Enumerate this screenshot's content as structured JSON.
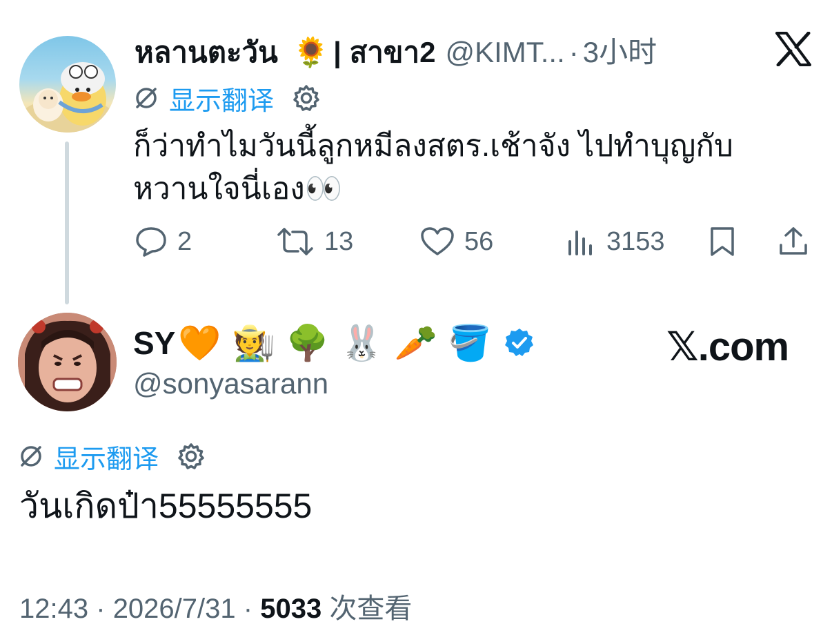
{
  "parent_tweet": {
    "display_name": "หลานตะวัน",
    "name_emoji": "🌻",
    "name_suffix": "| สาขา2",
    "handle": "@KIMT...",
    "separator": "·",
    "time_ago": "3小时",
    "translate_label": "显示翻译",
    "text_line1": "ก็ว่าทำไมวันนี้ลูกหมีลงสตร.เช้าจัง ไปทำบุญกับ",
    "text_line2": "หวานใจนี่เอง",
    "text_emoji": "👀",
    "stats": {
      "replies": "2",
      "retweets": "13",
      "likes": "56",
      "views": "3153"
    }
  },
  "reply_tweet": {
    "display_name": "SY",
    "name_emojis": [
      "🧡",
      "🧑‍🌾",
      "🌳",
      "🐰",
      "🥕",
      "🪣"
    ],
    "verified": true,
    "handle": "@sonyasarann",
    "translate_label": "显示翻译",
    "text": "วันเกิดป๋า55555555",
    "footer": {
      "time": "12:43",
      "dot": "·",
      "date": "2026/7/31",
      "views_count": "5033",
      "views_label": "次查看"
    }
  },
  "watermark": "𝕏.com",
  "icons": {
    "translate": "translate-slash-icon",
    "settings": "gear-icon",
    "reply": "speech-bubble-icon",
    "retweet": "retweet-arrows-icon",
    "like": "heart-icon",
    "views": "bar-chart-icon",
    "bookmark": "bookmark-icon",
    "share": "share-upload-icon",
    "brand": "x-logo-icon",
    "verified": "verified-badge-icon"
  },
  "colors": {
    "link_blue": "#1d9bf0",
    "muted_gray": "#536471",
    "thread_line": "#cfd9de",
    "text": "#0f1419"
  }
}
